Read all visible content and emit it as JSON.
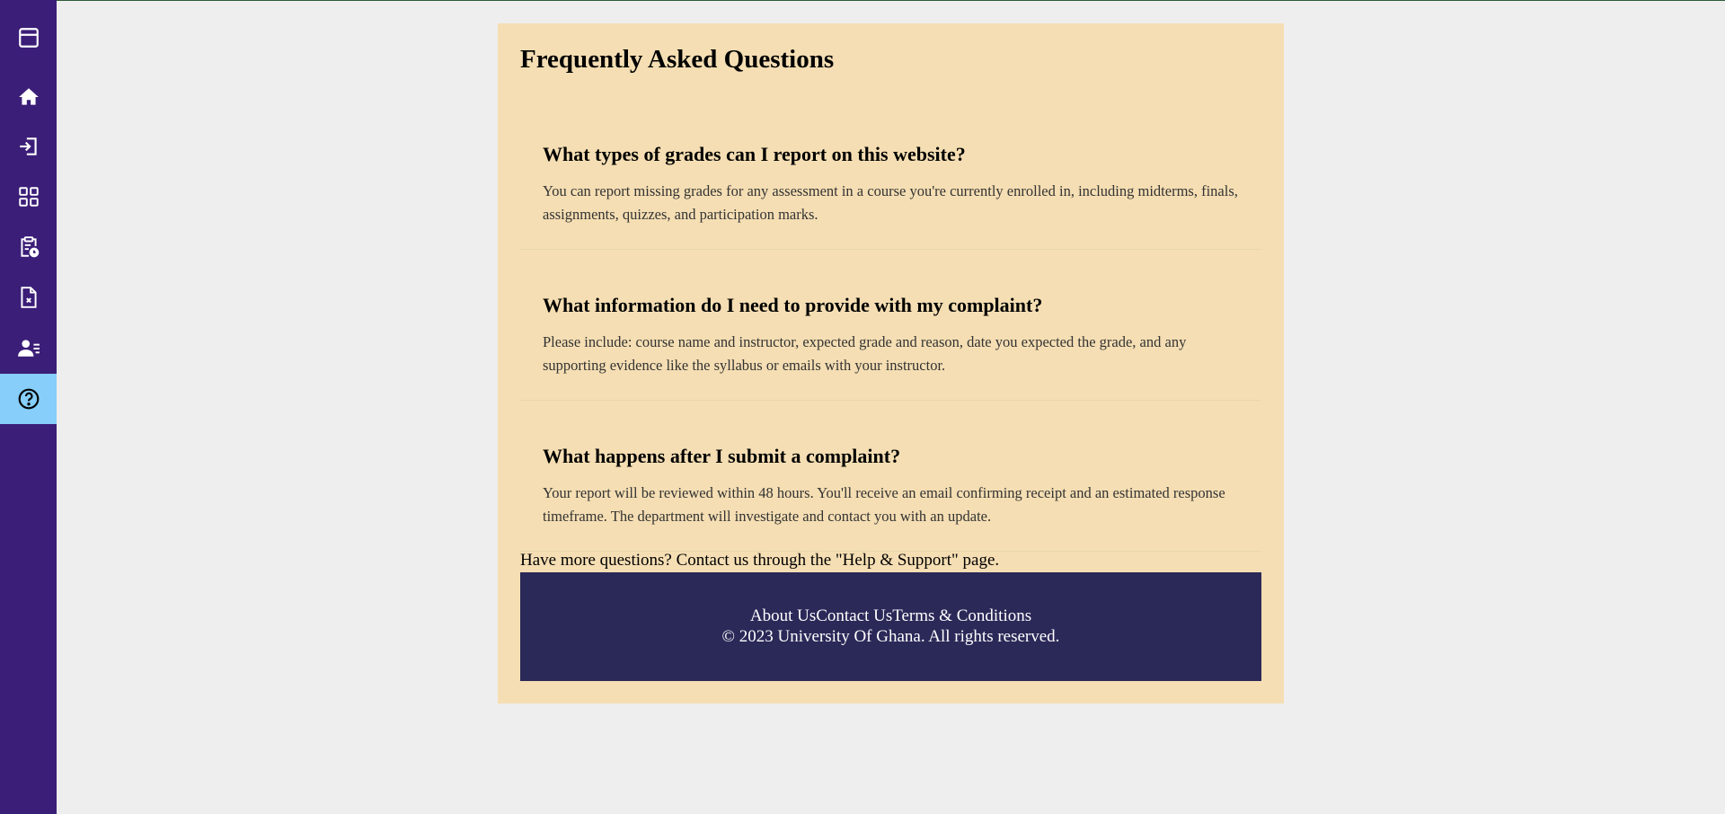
{
  "sidebar": {
    "items": [
      {
        "icon": "window-icon"
      },
      {
        "icon": "home-icon"
      },
      {
        "icon": "sign-in-icon"
      },
      {
        "icon": "dashboard-grid-icon"
      },
      {
        "icon": "clipboard-clock-icon"
      },
      {
        "icon": "file-x-icon"
      },
      {
        "icon": "user-list-icon"
      },
      {
        "icon": "help-circle-icon",
        "active": true
      }
    ],
    "colors": {
      "background": "#3b1e78",
      "active": "#87cefa"
    }
  },
  "main": {
    "title": "Frequently Asked Questions",
    "faqs": [
      {
        "question": "What types of grades can I report on this website?",
        "answer": "You can report missing grades for any assessment in a course you're currently enrolled in, including midterms, finals, assignments, quizzes, and participation marks."
      },
      {
        "question": "What information do I need to provide with my complaint?",
        "answer": "Please include: course name and instructor, expected grade and reason, date you expected the grade, and any supporting evidence like the syllabus or emails with your instructor."
      },
      {
        "question": "What happens after I submit a complaint?",
        "answer": "Your report will be reviewed within 48 hours. You'll receive an email confirming receipt and an estimated response timeframe. The department will investigate and contact you with an update."
      }
    ],
    "more_questions": "Have more questions? Contact us through the \"Help & Support\" page."
  },
  "footer": {
    "links": [
      "About Us",
      "Contact Us",
      "Terms & Conditions"
    ],
    "copyright": "© 2023 University Of Ghana. All rights reserved."
  },
  "colors": {
    "panel": "#f5deb3",
    "footer": "#2b2958",
    "page_bg": "#eeeeee"
  }
}
